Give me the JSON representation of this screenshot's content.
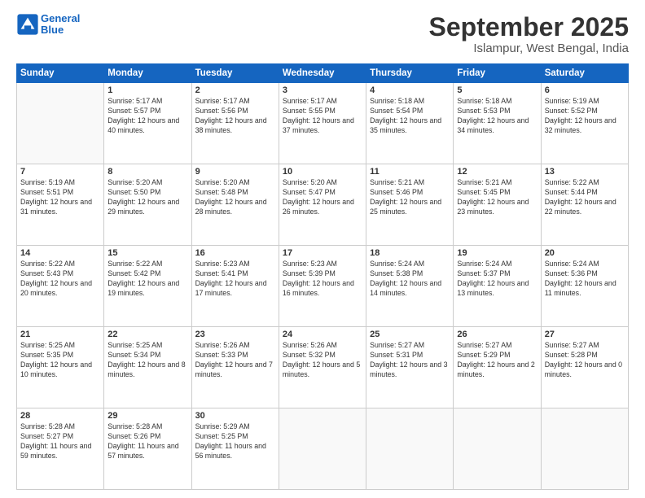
{
  "logo": {
    "line1": "General",
    "line2": "Blue"
  },
  "title": "September 2025",
  "location": "Islampur, West Bengal, India",
  "headers": [
    "Sunday",
    "Monday",
    "Tuesday",
    "Wednesday",
    "Thursday",
    "Friday",
    "Saturday"
  ],
  "weeks": [
    [
      {
        "num": "",
        "info": ""
      },
      {
        "num": "1",
        "info": "Sunrise: 5:17 AM\nSunset: 5:57 PM\nDaylight: 12 hours\nand 40 minutes."
      },
      {
        "num": "2",
        "info": "Sunrise: 5:17 AM\nSunset: 5:56 PM\nDaylight: 12 hours\nand 38 minutes."
      },
      {
        "num": "3",
        "info": "Sunrise: 5:17 AM\nSunset: 5:55 PM\nDaylight: 12 hours\nand 37 minutes."
      },
      {
        "num": "4",
        "info": "Sunrise: 5:18 AM\nSunset: 5:54 PM\nDaylight: 12 hours\nand 35 minutes."
      },
      {
        "num": "5",
        "info": "Sunrise: 5:18 AM\nSunset: 5:53 PM\nDaylight: 12 hours\nand 34 minutes."
      },
      {
        "num": "6",
        "info": "Sunrise: 5:19 AM\nSunset: 5:52 PM\nDaylight: 12 hours\nand 32 minutes."
      }
    ],
    [
      {
        "num": "7",
        "info": "Sunrise: 5:19 AM\nSunset: 5:51 PM\nDaylight: 12 hours\nand 31 minutes."
      },
      {
        "num": "8",
        "info": "Sunrise: 5:20 AM\nSunset: 5:50 PM\nDaylight: 12 hours\nand 29 minutes."
      },
      {
        "num": "9",
        "info": "Sunrise: 5:20 AM\nSunset: 5:48 PM\nDaylight: 12 hours\nand 28 minutes."
      },
      {
        "num": "10",
        "info": "Sunrise: 5:20 AM\nSunset: 5:47 PM\nDaylight: 12 hours\nand 26 minutes."
      },
      {
        "num": "11",
        "info": "Sunrise: 5:21 AM\nSunset: 5:46 PM\nDaylight: 12 hours\nand 25 minutes."
      },
      {
        "num": "12",
        "info": "Sunrise: 5:21 AM\nSunset: 5:45 PM\nDaylight: 12 hours\nand 23 minutes."
      },
      {
        "num": "13",
        "info": "Sunrise: 5:22 AM\nSunset: 5:44 PM\nDaylight: 12 hours\nand 22 minutes."
      }
    ],
    [
      {
        "num": "14",
        "info": "Sunrise: 5:22 AM\nSunset: 5:43 PM\nDaylight: 12 hours\nand 20 minutes."
      },
      {
        "num": "15",
        "info": "Sunrise: 5:22 AM\nSunset: 5:42 PM\nDaylight: 12 hours\nand 19 minutes."
      },
      {
        "num": "16",
        "info": "Sunrise: 5:23 AM\nSunset: 5:41 PM\nDaylight: 12 hours\nand 17 minutes."
      },
      {
        "num": "17",
        "info": "Sunrise: 5:23 AM\nSunset: 5:39 PM\nDaylight: 12 hours\nand 16 minutes."
      },
      {
        "num": "18",
        "info": "Sunrise: 5:24 AM\nSunset: 5:38 PM\nDaylight: 12 hours\nand 14 minutes."
      },
      {
        "num": "19",
        "info": "Sunrise: 5:24 AM\nSunset: 5:37 PM\nDaylight: 12 hours\nand 13 minutes."
      },
      {
        "num": "20",
        "info": "Sunrise: 5:24 AM\nSunset: 5:36 PM\nDaylight: 12 hours\nand 11 minutes."
      }
    ],
    [
      {
        "num": "21",
        "info": "Sunrise: 5:25 AM\nSunset: 5:35 PM\nDaylight: 12 hours\nand 10 minutes."
      },
      {
        "num": "22",
        "info": "Sunrise: 5:25 AM\nSunset: 5:34 PM\nDaylight: 12 hours\nand 8 minutes."
      },
      {
        "num": "23",
        "info": "Sunrise: 5:26 AM\nSunset: 5:33 PM\nDaylight: 12 hours\nand 7 minutes."
      },
      {
        "num": "24",
        "info": "Sunrise: 5:26 AM\nSunset: 5:32 PM\nDaylight: 12 hours\nand 5 minutes."
      },
      {
        "num": "25",
        "info": "Sunrise: 5:27 AM\nSunset: 5:31 PM\nDaylight: 12 hours\nand 3 minutes."
      },
      {
        "num": "26",
        "info": "Sunrise: 5:27 AM\nSunset: 5:29 PM\nDaylight: 12 hours\nand 2 minutes."
      },
      {
        "num": "27",
        "info": "Sunrise: 5:27 AM\nSunset: 5:28 PM\nDaylight: 12 hours\nand 0 minutes."
      }
    ],
    [
      {
        "num": "28",
        "info": "Sunrise: 5:28 AM\nSunset: 5:27 PM\nDaylight: 11 hours\nand 59 minutes."
      },
      {
        "num": "29",
        "info": "Sunrise: 5:28 AM\nSunset: 5:26 PM\nDaylight: 11 hours\nand 57 minutes."
      },
      {
        "num": "30",
        "info": "Sunrise: 5:29 AM\nSunset: 5:25 PM\nDaylight: 11 hours\nand 56 minutes."
      },
      {
        "num": "",
        "info": ""
      },
      {
        "num": "",
        "info": ""
      },
      {
        "num": "",
        "info": ""
      },
      {
        "num": "",
        "info": ""
      }
    ]
  ]
}
